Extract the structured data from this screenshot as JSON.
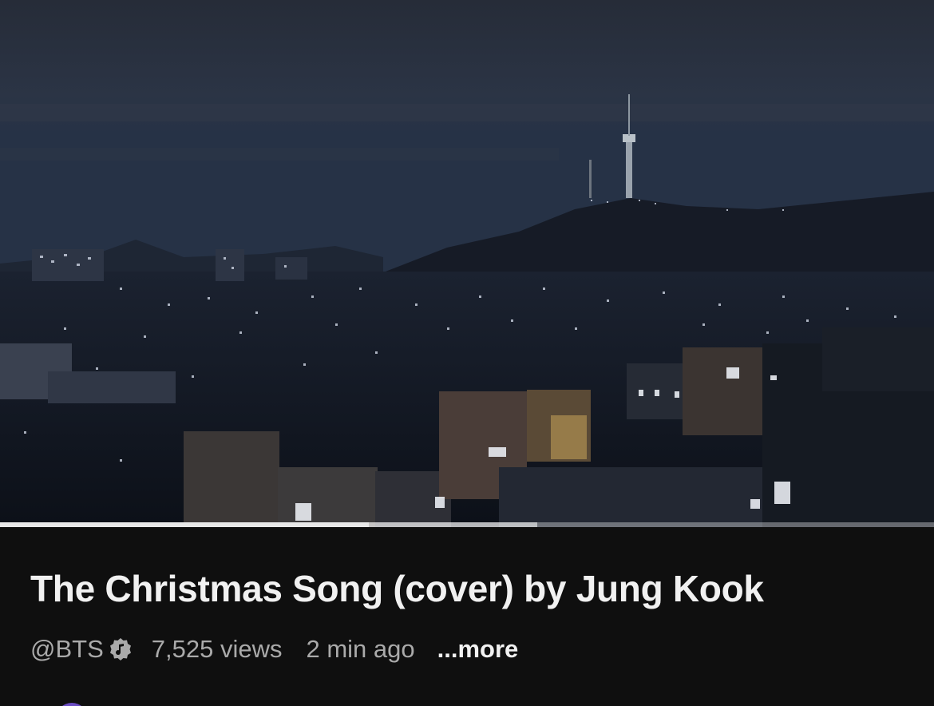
{
  "video": {
    "progress_played": 0.395,
    "progress_buffered": 0.575
  },
  "info": {
    "title": "The Christmas Song (cover) by Jung Kook",
    "channel": "@BTS",
    "verified_icon": "music-note-verified-icon",
    "views": "7,525 views",
    "time": "2 min ago",
    "more": "...more"
  },
  "colors": {
    "background": "#0f0f0f",
    "title": "#f1f1f1",
    "meta": "#aaaaaa"
  }
}
